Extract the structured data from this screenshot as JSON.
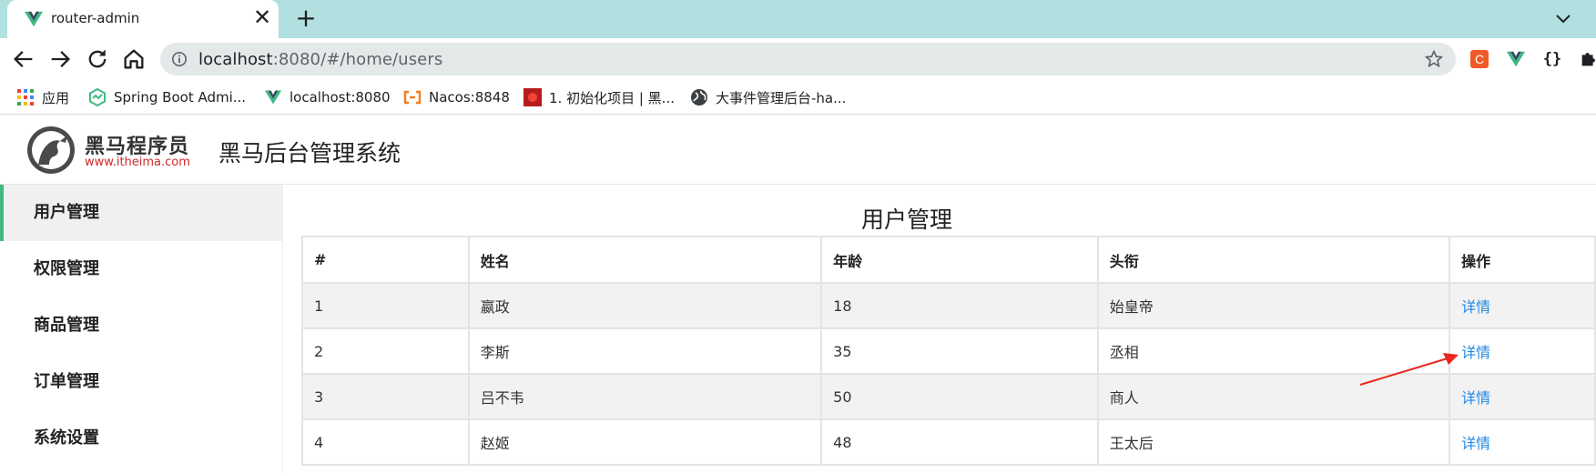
{
  "browser": {
    "tab": {
      "title": "router-admin",
      "close_glyph": "✕"
    },
    "new_tab_glyph": "+",
    "address": {
      "host": "localhost",
      "rest": ":8080/#/home/users"
    },
    "bookmarks": [
      {
        "label": "应用",
        "icon": "apps-grid-icon"
      },
      {
        "label": "Spring Boot Admi...",
        "icon": "spring-boot-admin-icon"
      },
      {
        "label": "localhost:8080",
        "icon": "vue-logo-icon"
      },
      {
        "label": "Nacos:8848",
        "icon": "nacos-icon"
      },
      {
        "label": "1. 初始化项目 | 黑...",
        "icon": "red-site-icon"
      },
      {
        "label": "大事件管理后台-ha...",
        "icon": "globe-icon"
      }
    ],
    "extensions": [
      {
        "name": "c-extension-icon",
        "glyph": "C",
        "color": "#f05a28"
      },
      {
        "name": "vue-devtools-icon"
      },
      {
        "name": "json-extension-icon",
        "glyph": "{}"
      },
      {
        "name": "puzzle-extension-icon"
      }
    ]
  },
  "app": {
    "logo": {
      "name": "黑马程序员",
      "url": "www.itheima.com"
    },
    "title": "黑马后台管理系统",
    "accent": "#42b983",
    "link_color": "#1e88e5"
  },
  "sidebar": {
    "items": [
      {
        "label": "用户管理",
        "active": true
      },
      {
        "label": "权限管理",
        "active": false
      },
      {
        "label": "商品管理",
        "active": false
      },
      {
        "label": "订单管理",
        "active": false
      },
      {
        "label": "系统设置",
        "active": false
      }
    ]
  },
  "main": {
    "title": "用户管理",
    "table": {
      "columns": [
        "#",
        "姓名",
        "年龄",
        "头衔",
        "操作"
      ],
      "rows": [
        {
          "id": "1",
          "name": "嬴政",
          "age": "18",
          "title": "始皇帝",
          "action": "详情"
        },
        {
          "id": "2",
          "name": "李斯",
          "age": "35",
          "title": "丞相",
          "action": "详情"
        },
        {
          "id": "3",
          "name": "吕不韦",
          "age": "50",
          "title": "商人",
          "action": "详情"
        },
        {
          "id": "4",
          "name": "赵姬",
          "age": "48",
          "title": "王太后",
          "action": "详情"
        }
      ]
    }
  },
  "annotation": {
    "arrow_color": "#e8281e"
  }
}
